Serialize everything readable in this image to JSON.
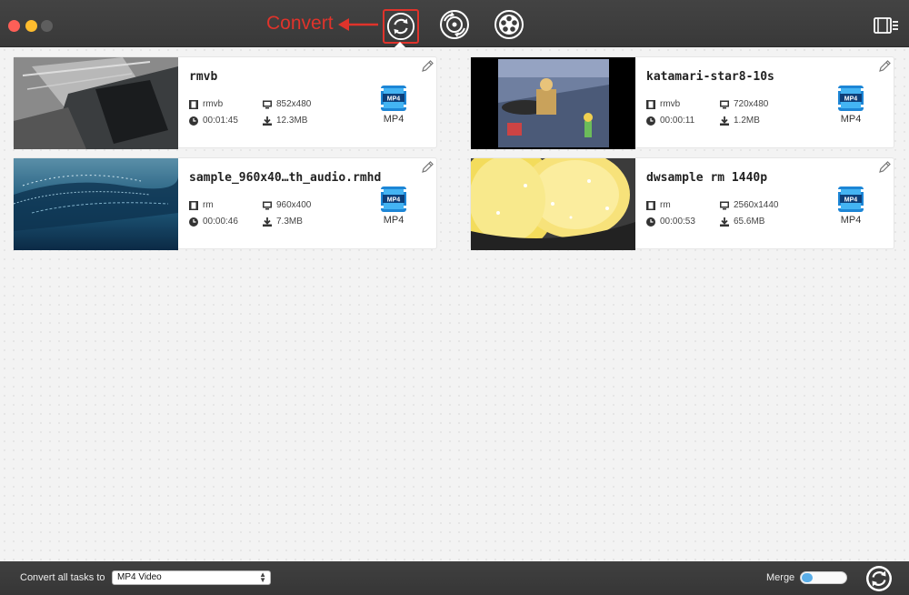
{
  "toolbar": {
    "annotation_label": "Convert",
    "tools": [
      {
        "name": "convert-icon"
      },
      {
        "name": "audio-video-convert-icon"
      },
      {
        "name": "film-reel-icon"
      }
    ],
    "right_tool": "media-list-icon"
  },
  "tasks": [
    {
      "title": "rmvb",
      "format": "rmvb",
      "duration": "00:01:45",
      "resolution": "852x480",
      "size": "12.3MB",
      "target": "MP4"
    },
    {
      "title": "katamari-star8-10s",
      "format": "rmvb",
      "duration": "00:00:11",
      "resolution": "720x480",
      "size": "1.2MB",
      "target": "MP4"
    },
    {
      "title": "sample_960x40…th_audio.rmhd",
      "format": "rm",
      "duration": "00:00:46",
      "resolution": "960x400",
      "size": "7.3MB",
      "target": "MP4"
    },
    {
      "title": "dwsample rm 1440p",
      "format": "rm",
      "duration": "00:00:53",
      "resolution": "2560x1440",
      "size": "65.6MB",
      "target": "MP4"
    }
  ],
  "bottom": {
    "convert_all_label": "Convert all tasks to",
    "format_value": "MP4 Video",
    "merge_label": "Merge"
  },
  "colors": {
    "accent": "#e0332b",
    "toggle": "#5aaee8",
    "toolbar": "#3d3d3d"
  }
}
